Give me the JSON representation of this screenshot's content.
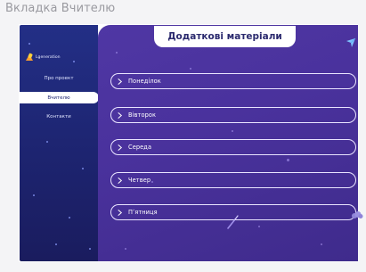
{
  "caption": "Вкладка Вчителю",
  "sidebar": {
    "logo_text": "Lgeneration",
    "items": [
      {
        "label": "Про проект",
        "active": false
      },
      {
        "label": "Вчителю",
        "active": true
      },
      {
        "label": "Контакти",
        "active": false
      }
    ]
  },
  "main": {
    "title": "Додаткові матеріали",
    "days": [
      {
        "label": "Понеділок"
      },
      {
        "label": "Вівторок"
      },
      {
        "label": "Середа"
      },
      {
        "label": "Четвер"
      },
      {
        "label": "Пʼятниця"
      }
    ]
  },
  "colors": {
    "sidebar_bg": "#1f2672",
    "main_bg": "#4b349e",
    "accent_white": "#ffffff",
    "send_icon": "#7ec3ff"
  },
  "icons": {
    "logo": "generation-logo-icon",
    "send": "paper-plane-icon",
    "chevron": "chevron-right-icon",
    "rocket": "rocket-icon",
    "cloud": "cloud-icon"
  }
}
